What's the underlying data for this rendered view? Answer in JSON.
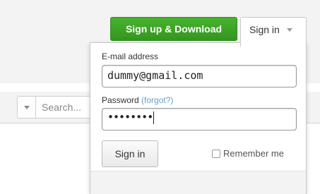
{
  "header": {
    "signup_label": "Sign up & Download",
    "signin_toggle_label": "Sign in"
  },
  "toolbar": {
    "search_placeholder": "Search..."
  },
  "login": {
    "email_label": "E-mail address",
    "email_value": "dummy@gmail.com",
    "password_label": "Password",
    "forgot_label": "(forgot?)",
    "password_mask": "••••••••",
    "signin_button": "Sign in",
    "remember_label": "Remember me"
  },
  "colors": {
    "signup_green": "#3aa526",
    "link_blue": "#6a9fc9"
  }
}
